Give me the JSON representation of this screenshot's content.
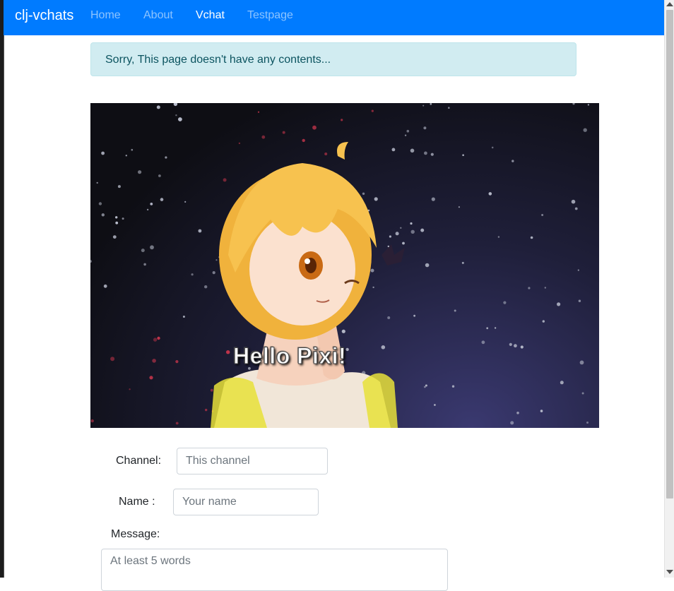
{
  "navbar": {
    "brand": "clj-vchats",
    "links": [
      {
        "label": "Home",
        "active": false
      },
      {
        "label": "About",
        "active": false
      },
      {
        "label": "Vchat",
        "active": true
      },
      {
        "label": "Testpage",
        "active": false
      }
    ]
  },
  "alert": {
    "message": "Sorry, This page doesn't have any contents..."
  },
  "stage": {
    "text": "Hello Pixi!"
  },
  "form": {
    "channel_label": "Channel:",
    "channel_placeholder": "This channel",
    "name_label": "Name :",
    "name_placeholder": "Your name",
    "message_label": "Message:",
    "message_placeholder": "At least 5 words"
  },
  "colors": {
    "navbar": "#007bff",
    "alert_bg": "#d1ecf1",
    "alert_text": "#0c5460"
  }
}
